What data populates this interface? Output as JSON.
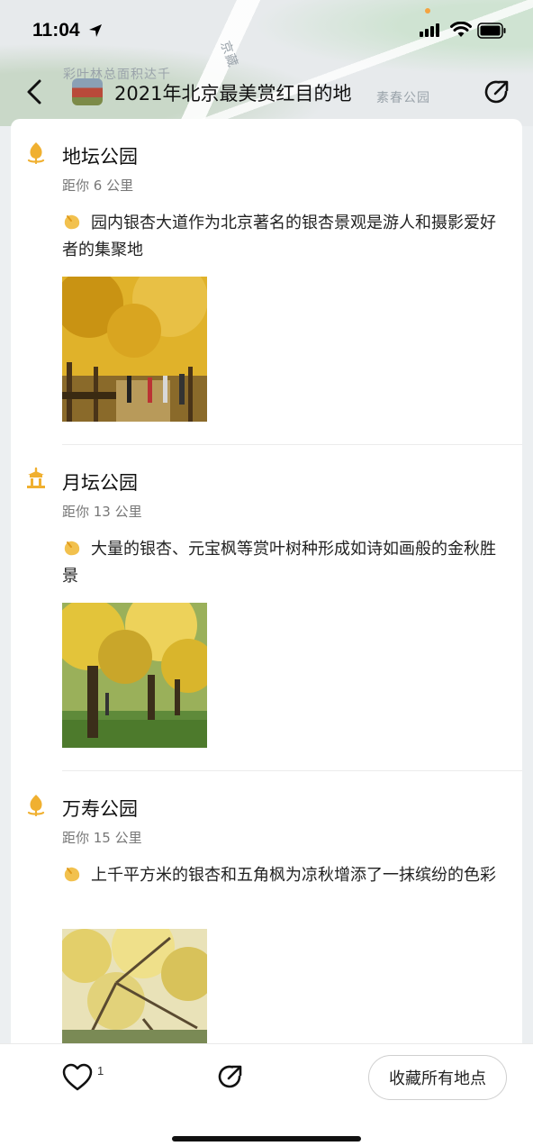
{
  "status_bar": {
    "time": "11:04"
  },
  "map_labels": {
    "top_left": "彩叶林总面积达千",
    "road": "京藏",
    "right": "素春公园"
  },
  "header": {
    "title": "2021年北京最美赏红目的地"
  },
  "places": [
    {
      "name": "地坛公园",
      "distance": "距你 6 公里",
      "description": "园内银杏大道作为北京著名的银杏景观是游人和摄影爱好者的集聚地",
      "icon": "tree-icon"
    },
    {
      "name": "月坛公园",
      "distance": "距你 13 公里",
      "description": "大量的银杏、元宝枫等赏叶树种形成如诗如画般的金秋胜景",
      "icon": "pavilion-icon"
    },
    {
      "name": "万寿公园",
      "distance": "距你 15 公里",
      "description": "上千平方米的银杏和五角枫为凉秋增添了一抹缤纷的色彩",
      "icon": "tree-icon"
    }
  ],
  "bottom_bar": {
    "like_count": "1",
    "save_all_label": "收藏所有地点"
  },
  "colors": {
    "accent": "#f0b030",
    "text": "#111111",
    "muted": "#777777"
  }
}
